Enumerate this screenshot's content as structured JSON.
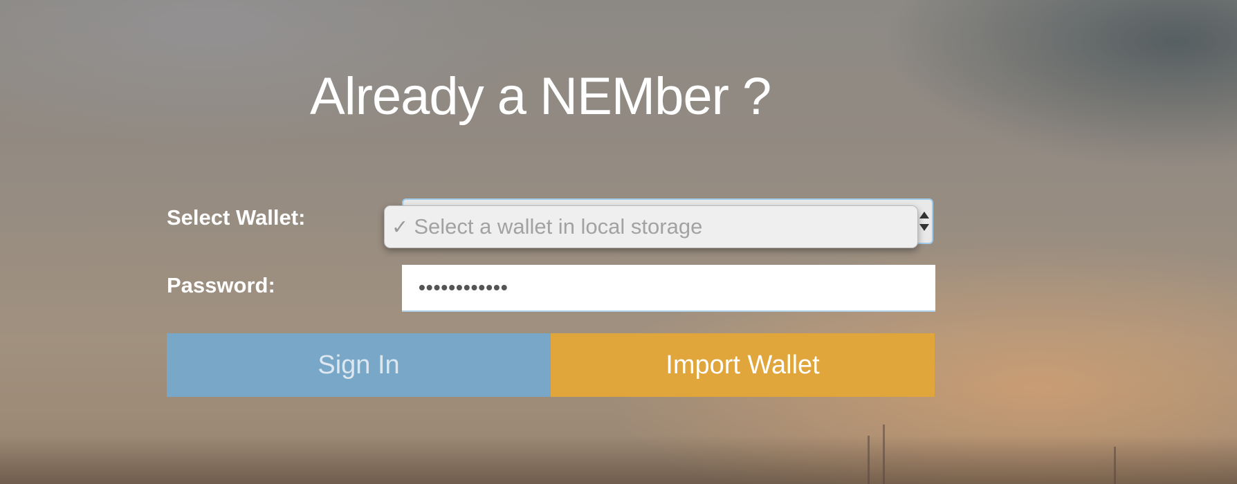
{
  "login": {
    "title": "Already a NEMber ?",
    "select_wallet_label": "Select Wallet:",
    "password_label": "Password:",
    "wallet_select": {
      "selected_option": "Select a wallet in local storage",
      "checkmark": "✓"
    },
    "password_value": "••••••••••••",
    "sign_in_label": "Sign In",
    "import_wallet_label": "Import Wallet"
  },
  "colors": {
    "sign_in_button": "#79a7c7",
    "import_wallet_button": "#e0a63b",
    "focus_border": "#9ecbea"
  },
  "icons": {
    "dropdown_check": "checkmark-icon",
    "select_arrows": "updown-arrows-icon"
  }
}
